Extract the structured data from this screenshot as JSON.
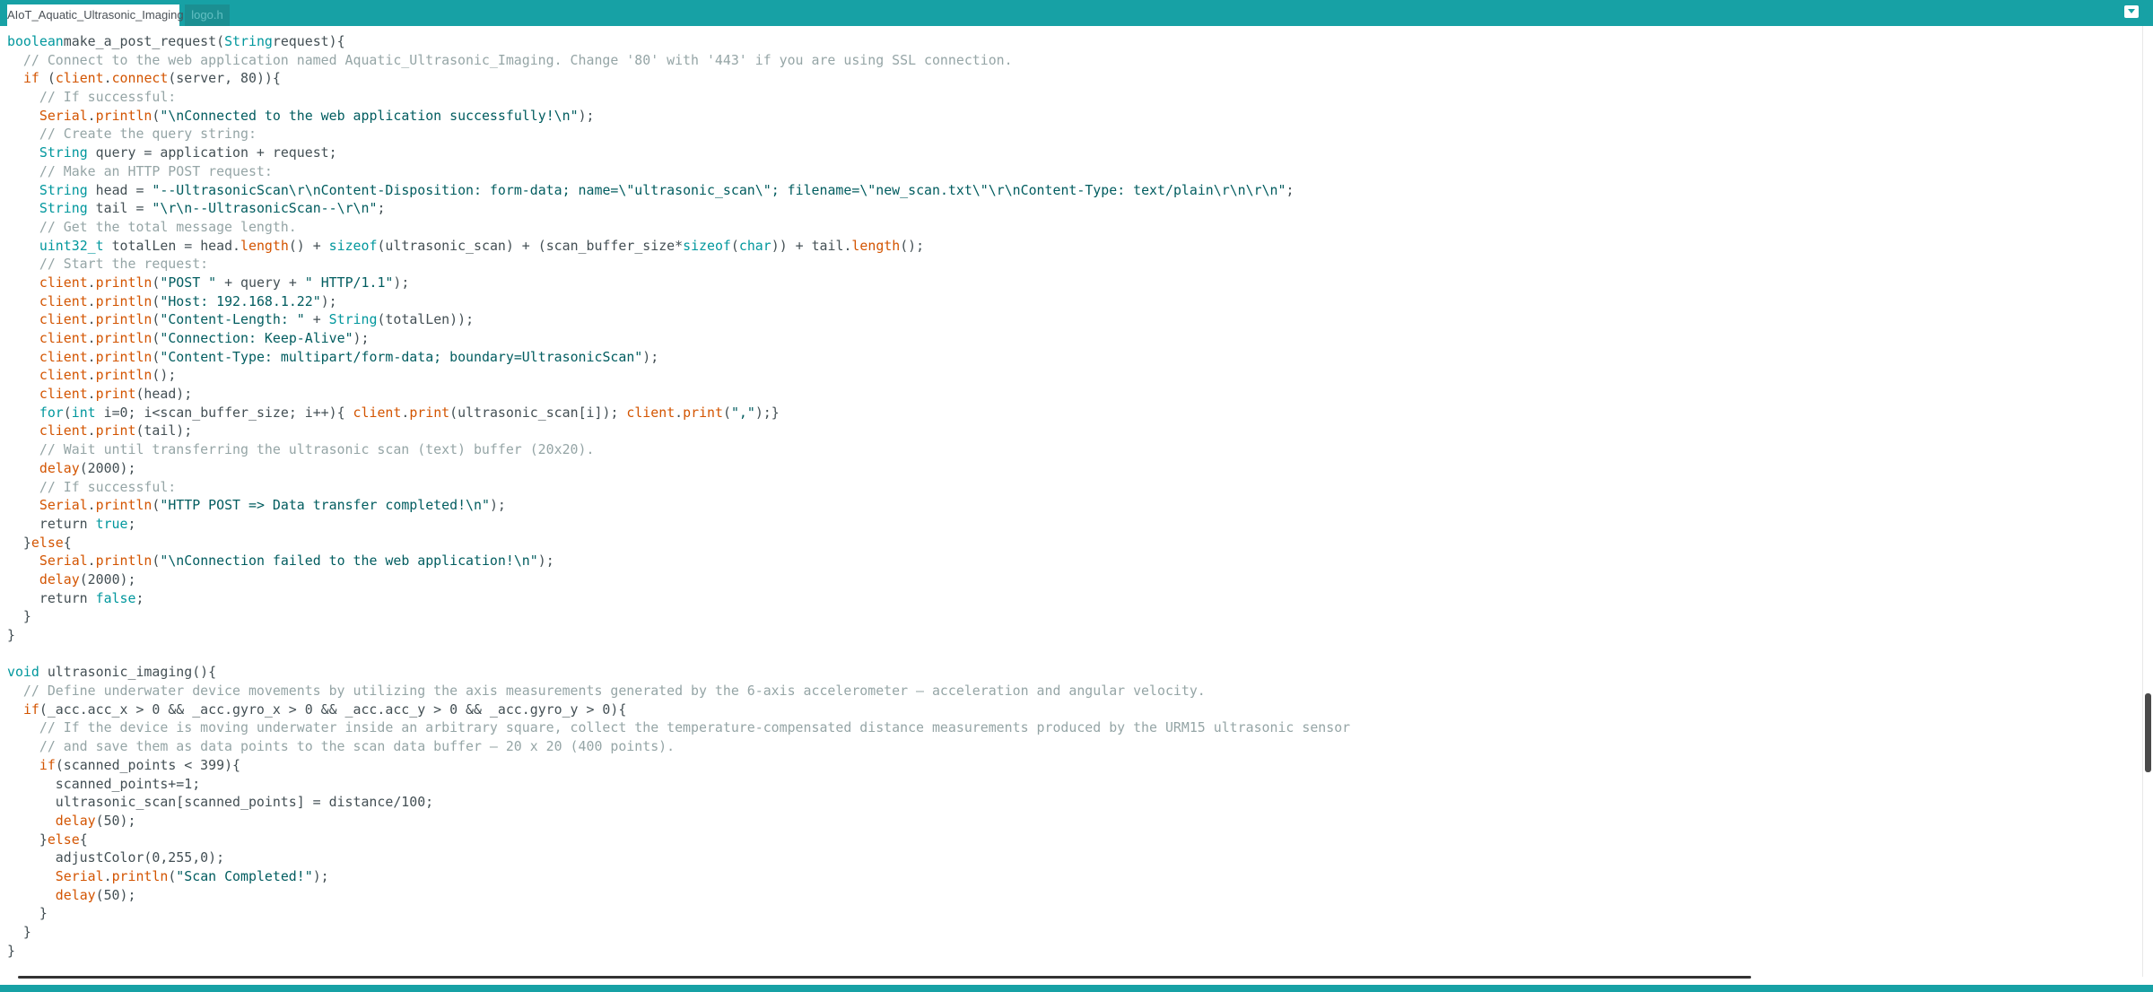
{
  "tabs": [
    {
      "label": "AIoT_Aquatic_Ultrasonic_Imaging",
      "active": true
    },
    {
      "label": "logo.h",
      "active": false
    }
  ],
  "tab_menu_icon": "chevron-down-icon",
  "colors": {
    "tab_bar": "#17a1a5",
    "keyword": "#00979d",
    "function": "#d35400",
    "comment": "#95a5a6",
    "string": "#005c5f",
    "text": "#434f54"
  },
  "code_lines": [
    [
      [
        "kw",
        "boolean"
      ],
      [
        "",
        "make_a_post_request("
      ],
      [
        "kw",
        "String"
      ],
      [
        "",
        "request){"
      ]
    ],
    [
      [
        "cm",
        "  // Connect to the web application named Aquatic_Ultrasonic_Imaging. Change '80' with '443' if you are using SSL connection."
      ]
    ],
    [
      [
        "",
        "  "
      ],
      [
        "fn",
        "if"
      ],
      [
        "",
        " ("
      ],
      [
        "fn",
        "client"
      ],
      [
        "",
        "."
      ],
      [
        "fn",
        "connect"
      ],
      [
        "",
        "(server, 80)){"
      ]
    ],
    [
      [
        "cm",
        "    // If successful:"
      ]
    ],
    [
      [
        "",
        "    "
      ],
      [
        "fn",
        "Serial"
      ],
      [
        "",
        "."
      ],
      [
        "fn",
        "println"
      ],
      [
        "",
        "("
      ],
      [
        "st",
        "\"\\nConnected to the web application successfully!\\n\""
      ],
      [
        "",
        ");"
      ]
    ],
    [
      [
        "cm",
        "    // Create the query string:"
      ]
    ],
    [
      [
        "",
        "    "
      ],
      [
        "kw",
        "String"
      ],
      [
        "",
        " query = application + request;"
      ]
    ],
    [
      [
        "cm",
        "    // Make an HTTP POST request:"
      ]
    ],
    [
      [
        "",
        "    "
      ],
      [
        "kw",
        "String"
      ],
      [
        "",
        " head = "
      ],
      [
        "st",
        "\"--UltrasonicScan\\r\\nContent-Disposition: form-data; name=\\\"ultrasonic_scan\\\"; filename=\\\"new_scan.txt\\\"\\r\\nContent-Type: text/plain\\r\\n\\r\\n\""
      ],
      [
        "",
        ";"
      ]
    ],
    [
      [
        "",
        "    "
      ],
      [
        "kw",
        "String"
      ],
      [
        "",
        " tail = "
      ],
      [
        "st",
        "\"\\r\\n--UltrasonicScan--\\r\\n\""
      ],
      [
        "",
        ";"
      ]
    ],
    [
      [
        "cm",
        "    // Get the total message length."
      ]
    ],
    [
      [
        "",
        "    "
      ],
      [
        "kw",
        "uint32_t"
      ],
      [
        "",
        " totalLen = head."
      ],
      [
        "fn",
        "length"
      ],
      [
        "",
        "() + "
      ],
      [
        "kw",
        "sizeof"
      ],
      [
        "",
        "(ultrasonic_scan) + (scan_buffer_size*"
      ],
      [
        "kw",
        "sizeof"
      ],
      [
        "",
        "("
      ],
      [
        "kw",
        "char"
      ],
      [
        "",
        "))"
      ],
      [
        "",
        " + tail."
      ],
      [
        "fn",
        "length"
      ],
      [
        "",
        "();"
      ]
    ],
    [
      [
        "cm",
        "    // Start the request:"
      ]
    ],
    [
      [
        "",
        "    "
      ],
      [
        "fn",
        "client"
      ],
      [
        "",
        "."
      ],
      [
        "fn",
        "println"
      ],
      [
        "",
        "("
      ],
      [
        "st",
        "\"POST \""
      ],
      [
        "",
        " + query + "
      ],
      [
        "st",
        "\" HTTP/1.1\""
      ],
      [
        "",
        ");"
      ]
    ],
    [
      [
        "",
        "    "
      ],
      [
        "fn",
        "client"
      ],
      [
        "",
        "."
      ],
      [
        "fn",
        "println"
      ],
      [
        "",
        "("
      ],
      [
        "st",
        "\"Host: 192.168.1.22\""
      ],
      [
        "",
        ");"
      ]
    ],
    [
      [
        "",
        "    "
      ],
      [
        "fn",
        "client"
      ],
      [
        "",
        "."
      ],
      [
        "fn",
        "println"
      ],
      [
        "",
        "("
      ],
      [
        "st",
        "\"Content-Length: \""
      ],
      [
        "",
        " + "
      ],
      [
        "kw",
        "String"
      ],
      [
        "",
        "(totalLen));"
      ]
    ],
    [
      [
        "",
        "    "
      ],
      [
        "fn",
        "client"
      ],
      [
        "",
        "."
      ],
      [
        "fn",
        "println"
      ],
      [
        "",
        "("
      ],
      [
        "st",
        "\"Connection: Keep-Alive\""
      ],
      [
        "",
        ");"
      ]
    ],
    [
      [
        "",
        "    "
      ],
      [
        "fn",
        "client"
      ],
      [
        "",
        "."
      ],
      [
        "fn",
        "println"
      ],
      [
        "",
        "("
      ],
      [
        "st",
        "\"Content-Type: multipart/form-data; boundary=UltrasonicScan\""
      ],
      [
        "",
        ");"
      ]
    ],
    [
      [
        "",
        "    "
      ],
      [
        "fn",
        "client"
      ],
      [
        "",
        "."
      ],
      [
        "fn",
        "println"
      ],
      [
        "",
        "();"
      ]
    ],
    [
      [
        "",
        "    "
      ],
      [
        "fn",
        "client"
      ],
      [
        "",
        "."
      ],
      [
        "fn",
        "print"
      ],
      [
        "",
        "(head);"
      ]
    ],
    [
      [
        "",
        "    "
      ],
      [
        "kw",
        "for"
      ],
      [
        "",
        "("
      ],
      [
        "kw",
        "int"
      ],
      [
        "",
        " i=0; i<scan_buffer_size; i++){ "
      ],
      [
        "fn",
        "client"
      ],
      [
        "",
        "."
      ],
      [
        "fn",
        "print"
      ],
      [
        "",
        "(ultrasonic_scan[i]); "
      ],
      [
        "fn",
        "client"
      ],
      [
        "",
        "."
      ],
      [
        "fn",
        "print"
      ],
      [
        "",
        "("
      ],
      [
        "st",
        "\",\""
      ],
      [
        "",
        ");}"
      ]
    ],
    [
      [
        "",
        "    "
      ],
      [
        "fn",
        "client"
      ],
      [
        "",
        "."
      ],
      [
        "fn",
        "print"
      ],
      [
        "",
        "(tail);"
      ]
    ],
    [
      [
        "cm",
        "    // Wait until transferring the ultrasonic scan (text) buffer (20x20)."
      ]
    ],
    [
      [
        "",
        "    "
      ],
      [
        "fn",
        "delay"
      ],
      [
        "",
        "(2000);"
      ]
    ],
    [
      [
        "cm",
        "    // If successful:"
      ]
    ],
    [
      [
        "",
        "    "
      ],
      [
        "fn",
        "Serial"
      ],
      [
        "",
        "."
      ],
      [
        "fn",
        "println"
      ],
      [
        "",
        "("
      ],
      [
        "st",
        "\"HTTP POST => Data transfer completed!\\n\""
      ],
      [
        "",
        ");"
      ]
    ],
    [
      [
        "",
        "    return "
      ],
      [
        "kw",
        "true"
      ],
      [
        "",
        ";"
      ]
    ],
    [
      [
        "",
        "  }"
      ],
      [
        "fn",
        "else"
      ],
      [
        "",
        "{"
      ]
    ],
    [
      [
        "",
        "    "
      ],
      [
        "fn",
        "Serial"
      ],
      [
        "",
        "."
      ],
      [
        "fn",
        "println"
      ],
      [
        "",
        "("
      ],
      [
        "st",
        "\"\\nConnection failed to the web application!\\n\""
      ],
      [
        "",
        ");"
      ]
    ],
    [
      [
        "",
        "    "
      ],
      [
        "fn",
        "delay"
      ],
      [
        "",
        "(2000);"
      ]
    ],
    [
      [
        "",
        "    return "
      ],
      [
        "kw",
        "false"
      ],
      [
        "",
        ";"
      ]
    ],
    [
      [
        "",
        "  }"
      ]
    ],
    [
      [
        "",
        "}"
      ]
    ],
    [
      [
        "",
        ""
      ]
    ],
    [
      [
        "kw",
        "void"
      ],
      [
        "",
        " ultrasonic_imaging(){"
      ]
    ],
    [
      [
        "cm",
        "  // Define underwater device movements by utilizing the axis measurements generated by the 6-axis accelerometer — acceleration and angular velocity."
      ]
    ],
    [
      [
        "",
        "  "
      ],
      [
        "fn",
        "if"
      ],
      [
        "",
        "(_acc.acc_x > 0 && _acc.gyro_x > 0 && _acc.acc_y > 0 && _acc.gyro_y > 0){"
      ]
    ],
    [
      [
        "cm",
        "    // If the device is moving underwater inside an arbitrary square, collect the temperature-compensated distance measurements produced by the URM15 ultrasonic sensor"
      ]
    ],
    [
      [
        "cm",
        "    // and save them as data points to the scan data buffer — 20 x 20 (400 points)."
      ]
    ],
    [
      [
        "",
        "    "
      ],
      [
        "fn",
        "if"
      ],
      [
        "",
        "(scanned_points < 399){"
      ]
    ],
    [
      [
        "",
        "      scanned_points+=1;"
      ]
    ],
    [
      [
        "",
        "      ultrasonic_scan[scanned_points] = distance/100;"
      ]
    ],
    [
      [
        "",
        "      "
      ],
      [
        "fn",
        "delay"
      ],
      [
        "",
        "(50);"
      ]
    ],
    [
      [
        "",
        "    }"
      ],
      [
        "fn",
        "else"
      ],
      [
        "",
        "{"
      ]
    ],
    [
      [
        "",
        "      adjustColor(0,255,0);"
      ]
    ],
    [
      [
        "",
        "      "
      ],
      [
        "fn",
        "Serial"
      ],
      [
        "",
        "."
      ],
      [
        "fn",
        "println"
      ],
      [
        "",
        "("
      ],
      [
        "st",
        "\"Scan Completed!\""
      ],
      [
        "",
        ");"
      ]
    ],
    [
      [
        "",
        "      "
      ],
      [
        "fn",
        "delay"
      ],
      [
        "",
        "(50);"
      ]
    ],
    [
      [
        "",
        "    }"
      ]
    ],
    [
      [
        "",
        "  }"
      ]
    ],
    [
      [
        "",
        "}"
      ]
    ]
  ]
}
